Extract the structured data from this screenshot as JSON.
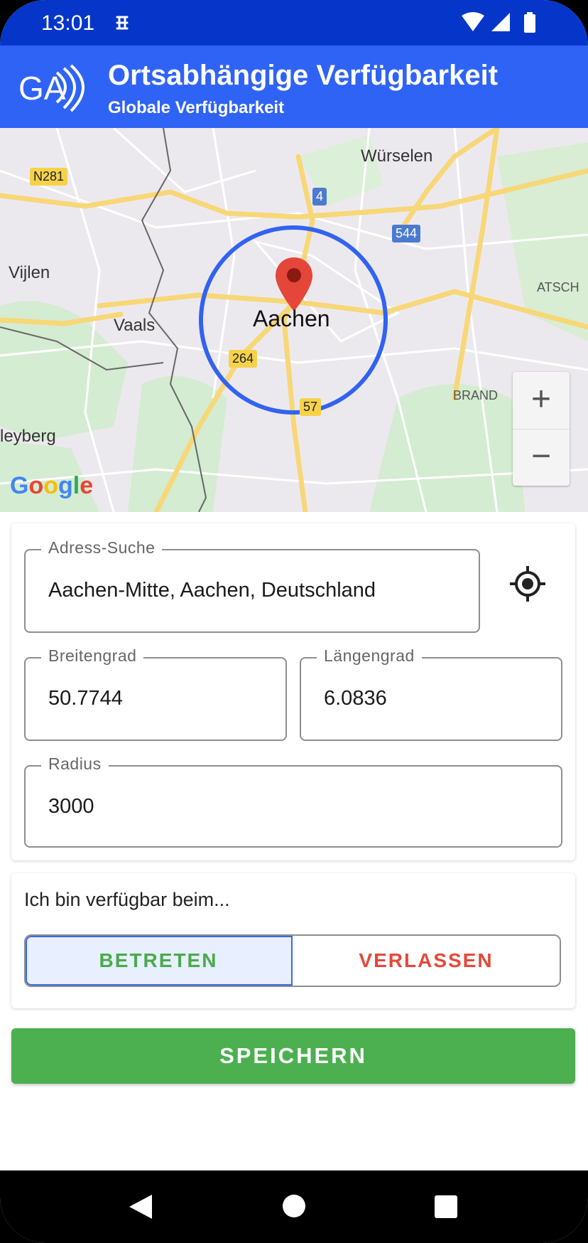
{
  "status_bar": {
    "time": "13:01",
    "icons": [
      "app-notification-icon",
      "wifi-icon",
      "signal-icon",
      "battery-icon"
    ]
  },
  "app_bar": {
    "logo_text": "GA",
    "title": "Ortsabhängige Verfügbarkeit",
    "subtitle": "Globale Verfügbarkeit"
  },
  "map": {
    "places": {
      "wuerselen": "Würselen",
      "vijlen": "Vijlen",
      "vaals": "Vaals",
      "aachen": "Aachen",
      "atsch": "ATSCH",
      "brand": "BRAND",
      "vijlenberg": "leyberg"
    },
    "roads": {
      "n281": "N281",
      "r4": "4",
      "r544": "544",
      "r264": "264",
      "r57": "57"
    },
    "zoom_in": "+",
    "zoom_out": "−",
    "attribution": "Google",
    "colors": {
      "circle": "#3263f0",
      "marker": "#e5463a",
      "road": "#f7d777"
    }
  },
  "form": {
    "address": {
      "label": "Adress-Suche",
      "value": "Aachen-Mitte, Aachen, Deutschland"
    },
    "latitude": {
      "label": "Breitengrad",
      "value": "50.7744"
    },
    "longitude": {
      "label": "Längengrad",
      "value": "6.0836"
    },
    "radius": {
      "label": "Radius",
      "value": "3000"
    }
  },
  "availability": {
    "prompt": "Ich bin verfügbar beim...",
    "enter_label": "BETRETEN",
    "leave_label": "VERLASSEN",
    "selected": "BETRETEN"
  },
  "save_label": "SPEICHERN",
  "colors": {
    "status_bar": "#0536c9",
    "app_bar": "#2f63f5",
    "save": "#4caf50",
    "enter_text": "#4aaa4c",
    "leave_text": "#e5483a"
  }
}
